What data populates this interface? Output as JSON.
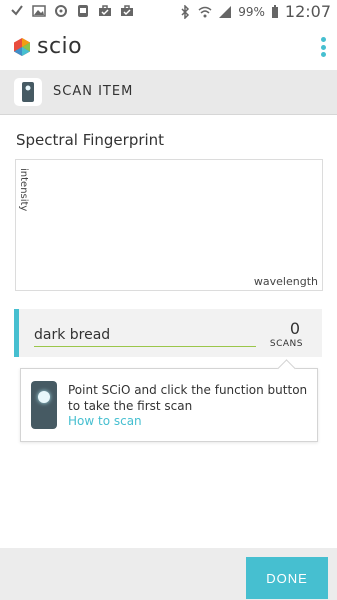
{
  "status_bar": {
    "battery": "99%",
    "time": "12:07",
    "left_icons": [
      "check-icon",
      "image-icon",
      "sync-icon",
      "evernote-icon",
      "briefcase-icon",
      "briefcase-check-icon"
    ],
    "right_icons": [
      "bluetooth-icon",
      "wifi-icon",
      "signal-icon",
      "battery-icon"
    ]
  },
  "app_bar": {
    "brand": "scio",
    "logo_colors": [
      "#e84c3d",
      "#f39c12",
      "#8bc34a",
      "#46bfd0"
    ],
    "menu_icon": "more-vert-icon"
  },
  "scan_header": {
    "title": "SCAN ITEM",
    "icon": "scio-device-icon"
  },
  "spectral": {
    "title": "Spectral Fingerprint",
    "ylabel": "intensity",
    "xlabel": "wavelength"
  },
  "item": {
    "name": "dark bread",
    "scans_count": "0",
    "scans_label": "SCANS"
  },
  "tooltip": {
    "text": "Point SCiO and click the function button to take the first scan",
    "link": "How to scan"
  },
  "bottom": {
    "done_label": "DONE"
  },
  "colors": {
    "accent": "#46bfd0",
    "underline": "#9bc64a",
    "header_bg": "#e9e9e9"
  }
}
